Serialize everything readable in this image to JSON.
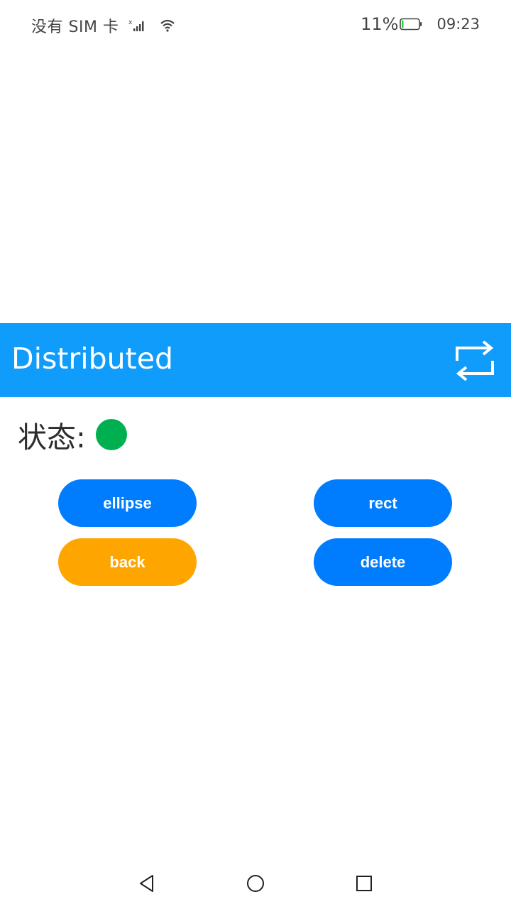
{
  "status_bar": {
    "carrier": "没有 SIM 卡",
    "battery_percent": "11%",
    "battery_level": 0.11,
    "time": "09:23",
    "icons": [
      "signal-icon",
      "wifi-icon",
      "battery-icon"
    ]
  },
  "app_bar": {
    "title": "Distributed",
    "action_icon": "switch-arrows-icon",
    "color": "#0f9cfb"
  },
  "state": {
    "label": "状态:",
    "indicator_color": "#00b050"
  },
  "buttons": {
    "ellipse": {
      "label": "ellipse",
      "color": "#007dff"
    },
    "rect": {
      "label": "rect",
      "color": "#007dff"
    },
    "back": {
      "label": "back",
      "color": "#ffa500"
    },
    "delete": {
      "label": "delete",
      "color": "#007dff"
    }
  },
  "nav_bar": {
    "icons": [
      "back-triangle-icon",
      "home-circle-icon",
      "recent-square-icon"
    ]
  }
}
